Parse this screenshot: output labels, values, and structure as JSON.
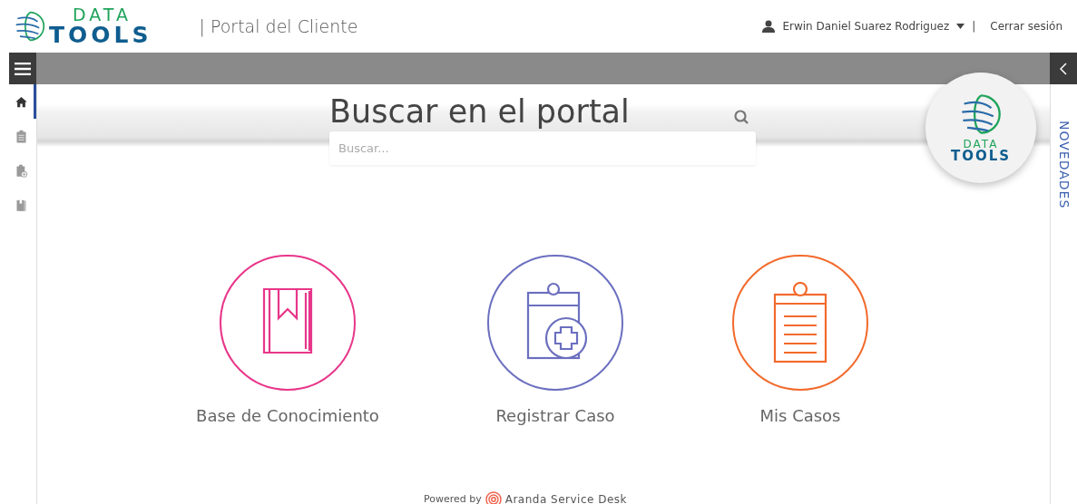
{
  "header": {
    "logo": {
      "line1": "DATA",
      "line2": "TOOLS"
    },
    "portal_title": "| Portal del Cliente",
    "user": {
      "name": "Erwin Daniel Suarez Rodriguez",
      "separator": "|"
    },
    "logout": "Cerrar sesión"
  },
  "sidebar": {
    "items": [
      {
        "kind": "home",
        "selected": true
      },
      {
        "kind": "clipboard",
        "selected": false
      },
      {
        "kind": "clipboard-add",
        "selected": false
      },
      {
        "kind": "book",
        "selected": false
      }
    ]
  },
  "search": {
    "title": "Buscar en el portal",
    "placeholder": "Buscar..."
  },
  "badge_logo": {
    "line1": "DATA",
    "line2": "TOOLS"
  },
  "rail": {
    "label": "NOVEDADES"
  },
  "tiles": [
    {
      "kind": "book",
      "label": "Base de Conocimiento",
      "color": "#e8368a"
    },
    {
      "kind": "clipboard-add",
      "label": "Registrar Caso",
      "color": "#6b6fbf"
    },
    {
      "kind": "clipboard",
      "label": "Mis Casos",
      "color": "#f26a2c"
    }
  ],
  "footer": {
    "powered_by": "Powered by",
    "brand": "Aranda Service Desk"
  }
}
